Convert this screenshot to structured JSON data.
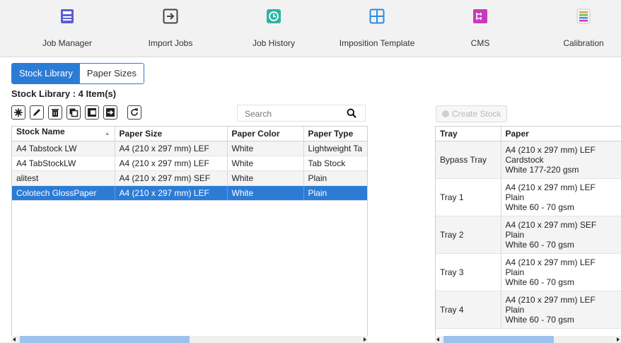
{
  "toolbar": {
    "items": [
      {
        "label": "Job Manager",
        "icon": "job-manager-icon",
        "color": "#5b5fd0"
      },
      {
        "label": "Import Jobs",
        "icon": "import-jobs-icon",
        "color": "#444444"
      },
      {
        "label": "Job History",
        "icon": "job-history-icon",
        "color": "#2bb5a3"
      },
      {
        "label": "Imposition Template",
        "icon": "imposition-template-icon",
        "color": "#2c8be0"
      },
      {
        "label": "CMS",
        "icon": "cms-icon",
        "color": "#c73bbd"
      },
      {
        "label": "Calibration",
        "icon": "calibration-icon",
        "color": "#e0a13a"
      }
    ]
  },
  "tabs": {
    "stock_library": "Stock Library",
    "paper_sizes": "Paper Sizes"
  },
  "stock": {
    "count_label": "Stock Library : 4 Item(s)",
    "actions": [
      "new-icon",
      "edit-icon",
      "delete-icon",
      "copy-icon",
      "import-icon",
      "export-icon",
      "refresh-icon"
    ],
    "search_placeholder": "Search",
    "columns": [
      "Stock Name",
      "Paper Size",
      "Paper Color",
      "Paper Type"
    ],
    "rows": [
      [
        "A4 Tabstock LW",
        "A4 (210 x 297 mm) LEF",
        "White",
        "Lightweight Ta"
      ],
      [
        "A4 TabStockLW",
        "A4 (210 x 297 mm) LEF",
        "White",
        "Tab Stock"
      ],
      [
        "alitest",
        "A4 (210 x 297 mm) SEF",
        "White",
        "Plain"
      ],
      [
        "Colotech  GlossPaper",
        "A4 (210 x 297 mm) LEF",
        "White",
        "Plain"
      ]
    ],
    "selected_row": 3
  },
  "trays": {
    "create_label": "Create Stock",
    "columns": [
      "Tray",
      "Paper"
    ],
    "rows": [
      {
        "tray": "Bypass Tray",
        "size": "A4 (210 x 297 mm) LEF",
        "type": "Cardstock",
        "spec": "White  177-220 gsm"
      },
      {
        "tray": "Tray 1",
        "size": "A4 (210 x 297 mm) LEF",
        "type": "Plain",
        "spec": "White  60 - 70 gsm"
      },
      {
        "tray": "Tray 2",
        "size": "A4 (210 x 297 mm) SEF",
        "type": "Plain",
        "spec": "White  60 - 70 gsm"
      },
      {
        "tray": "Tray 3",
        "size": "A4 (210 x 297 mm) LEF",
        "type": "Plain",
        "spec": "White  60 - 70 gsm"
      },
      {
        "tray": "Tray 4",
        "size": "A4 (210 x 297 mm) LEF",
        "type": "Plain",
        "spec": "White  60 - 70 gsm"
      }
    ]
  },
  "colors": {
    "accent": "#2c7cd6"
  }
}
